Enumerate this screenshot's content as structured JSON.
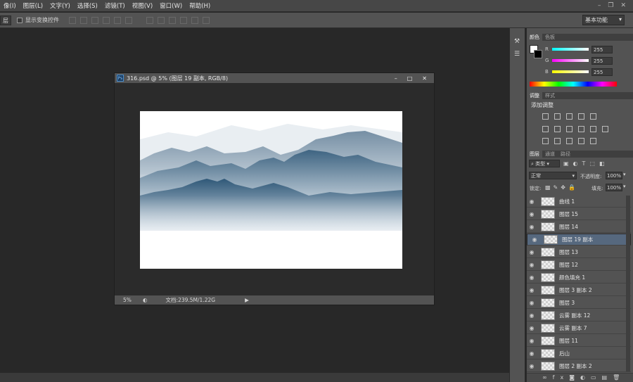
{
  "menu": [
    "像(I)",
    "图层(L)",
    "文字(Y)",
    "选择(S)",
    "滤镜(T)",
    "视图(V)",
    "窗口(W)",
    "帮助(H)"
  ],
  "options": {
    "layer_select": "层",
    "show_transform": "显示变换控件",
    "workspace": "基本功能"
  },
  "document": {
    "title": "316.psd @ 5% (图层 19 副本, RGB/8)",
    "ps_badge": "Ps",
    "zoom": "5%",
    "doc_info": "文档:239.5M/1.22G"
  },
  "color_panel": {
    "tabs": [
      "颜色",
      "色板"
    ],
    "channels": [
      {
        "label": "R",
        "value": "255",
        "color": "#ff4d4d"
      },
      {
        "label": "G",
        "value": "255",
        "color": "#36e6e6"
      },
      {
        "label": "B",
        "value": "255",
        "color": "#e6e61a"
      }
    ]
  },
  "adjust_panel": {
    "tabs": [
      "调整",
      "样式"
    ],
    "heading": "添加调整"
  },
  "layers_panel": {
    "tabs": [
      "图层",
      "通道",
      "路径"
    ],
    "filter": "类型",
    "blend": "正常",
    "opacity_label": "不透明度:",
    "opacity": "100%",
    "lock_label": "锁定:",
    "fill_label": "填充:",
    "fill": "100%",
    "layers": [
      {
        "name": "曲线 1"
      },
      {
        "name": "图层 15"
      },
      {
        "name": "图层 14"
      },
      {
        "name": "图层 19 副本",
        "selected": true
      },
      {
        "name": "图层 13"
      },
      {
        "name": "图层 12"
      },
      {
        "name": "颜色填充 1"
      },
      {
        "name": "图层 3 副本 2"
      },
      {
        "name": "图层 3"
      },
      {
        "name": "云雾 副本 12"
      },
      {
        "name": "云雾 副本 7"
      },
      {
        "name": "图层 11"
      },
      {
        "name": "后山"
      },
      {
        "name": "图层 2 副本 2"
      }
    ]
  }
}
